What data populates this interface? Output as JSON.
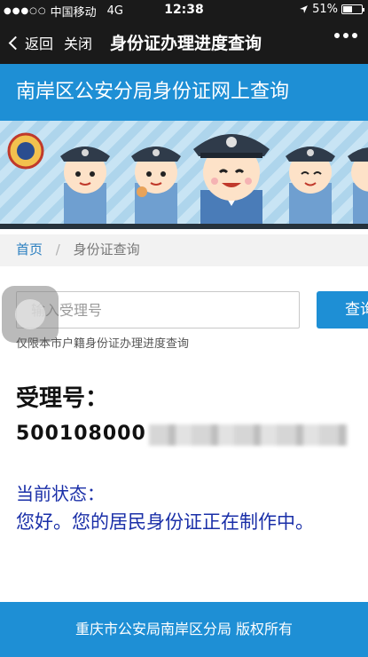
{
  "status_bar": {
    "signal": "●●●○○",
    "carrier": "中国移动",
    "network": "4G",
    "time": "12:38",
    "location_icon": "location-arrow-icon",
    "battery_text": "51%",
    "battery_level": 0.51
  },
  "nav": {
    "back_label": "返回",
    "close_label": "关闭",
    "title": "身份证办理进度查询",
    "more_icon": "more-dots-icon"
  },
  "site": {
    "header_title": "南岸区公安分局身份证网上查询"
  },
  "breadcrumb": {
    "home": "首页",
    "separator": "/",
    "current": "身份证查询"
  },
  "search": {
    "placeholder": "输入受理号",
    "button_label": "查询",
    "hint": "仅限本市户籍身份证办理进度查询"
  },
  "result": {
    "label": "受理号：",
    "number_visible": "500108000"
  },
  "status": {
    "label": "当前状态：",
    "text": "您好。您的居民身份证正在制作中。"
  },
  "footer": {
    "text": "重庆市公安局南岸区分局 版权所有"
  },
  "colors": {
    "accent_blue": "#1e8fd5",
    "status_text": "#1a2fa8",
    "nav_bg": "#1a1a1a"
  }
}
